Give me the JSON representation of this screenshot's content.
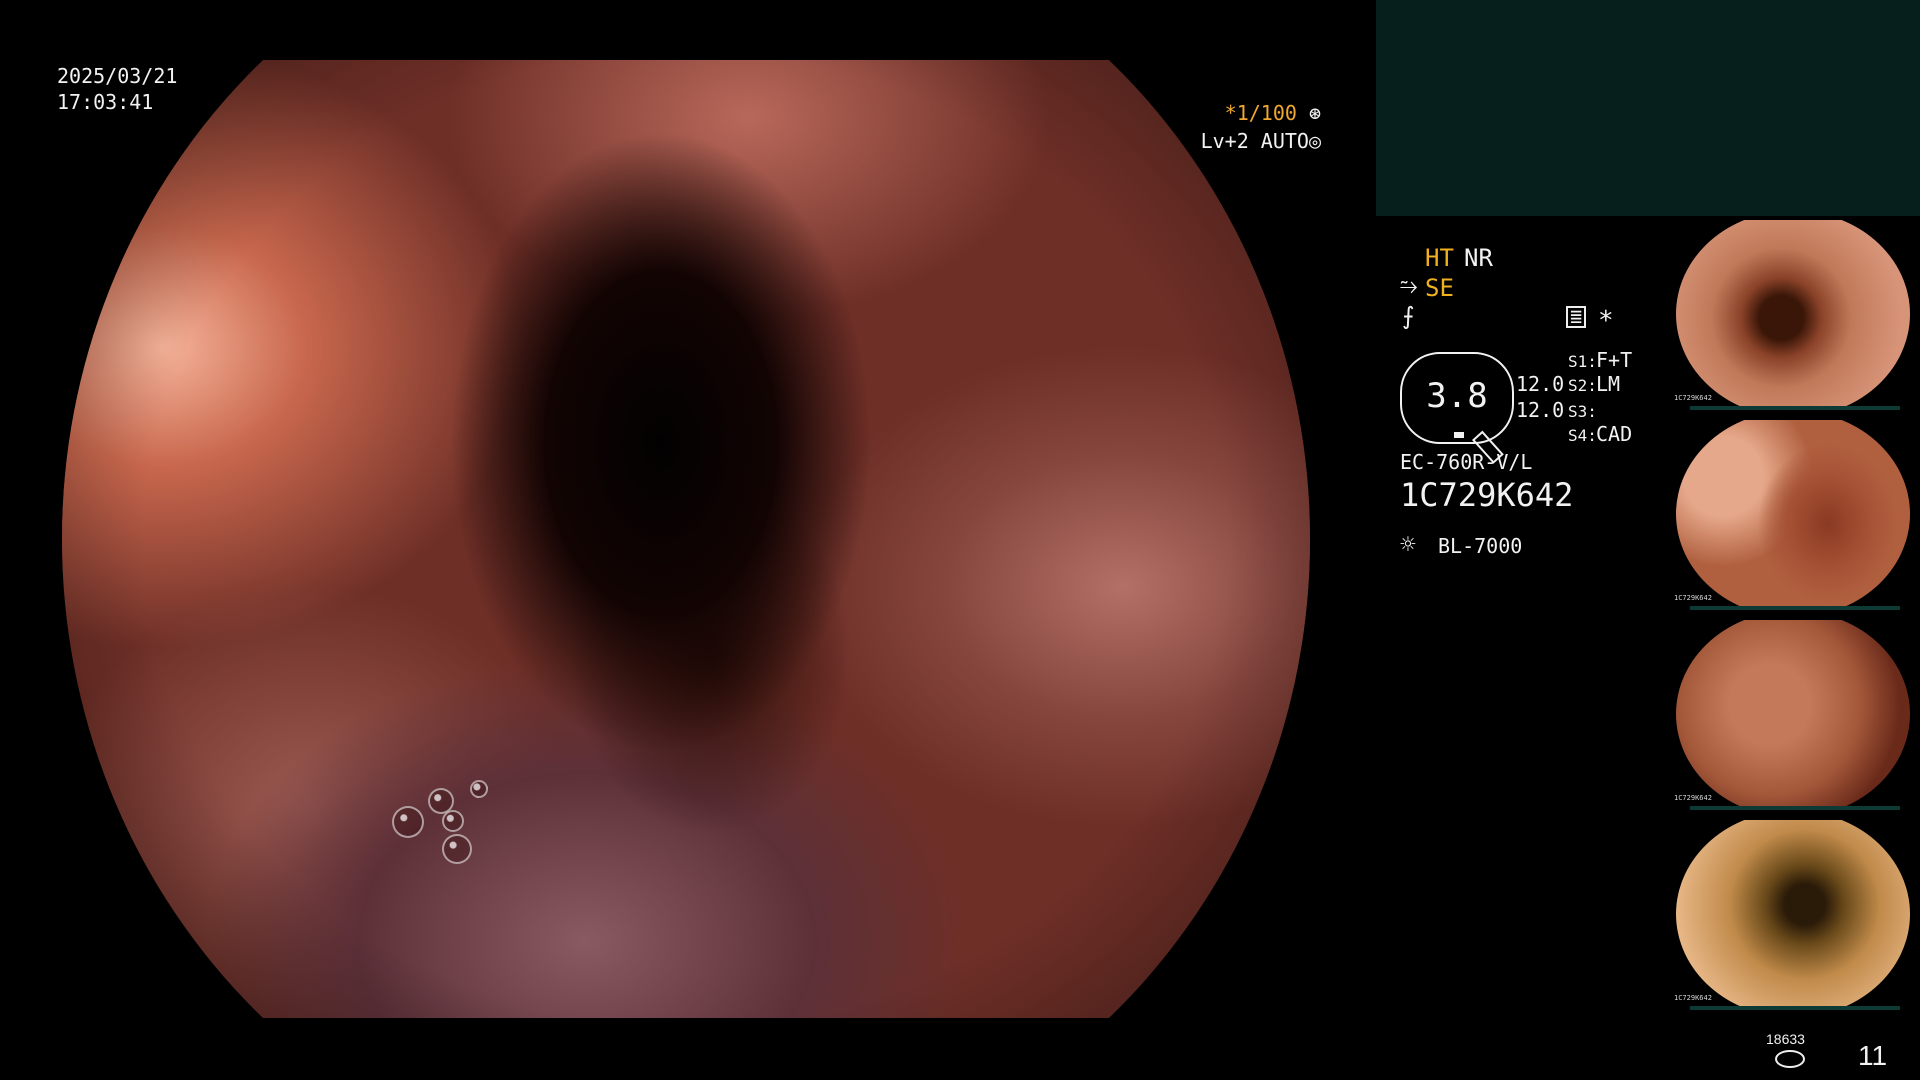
{
  "overlay": {
    "date": "2025/03/21",
    "time": "17:03:41",
    "exposure": "*1/100",
    "level": "Lv+2 AUTO"
  },
  "panel": {
    "ht": "HT",
    "nr": "NR",
    "se": "SE",
    "asterisk": "*",
    "gauge_value": "3.8",
    "val1": "12.0",
    "val2": "12.0",
    "s1": "S1:",
    "s1_val": "F+T",
    "s2": "S2:",
    "s2_val": "LM",
    "s3": "S3:",
    "s3_val": "",
    "s4": "S4:",
    "s4_val": "CAD",
    "scope_model": "EC-760R-V/L",
    "serial": "1C729K642",
    "light_source": "BL-7000"
  },
  "thumbnails": [
    {
      "caption": "1C729K642"
    },
    {
      "caption": "1C729K642"
    },
    {
      "caption": "1C729K642"
    },
    {
      "caption": "1C729K642"
    }
  ],
  "footer": {
    "image_count_small": "18633",
    "image_count_big": "11"
  },
  "colors": {
    "accent_yellow": "#f0b020",
    "panel_box": "#071f1c",
    "text": "#f2f2f2"
  }
}
